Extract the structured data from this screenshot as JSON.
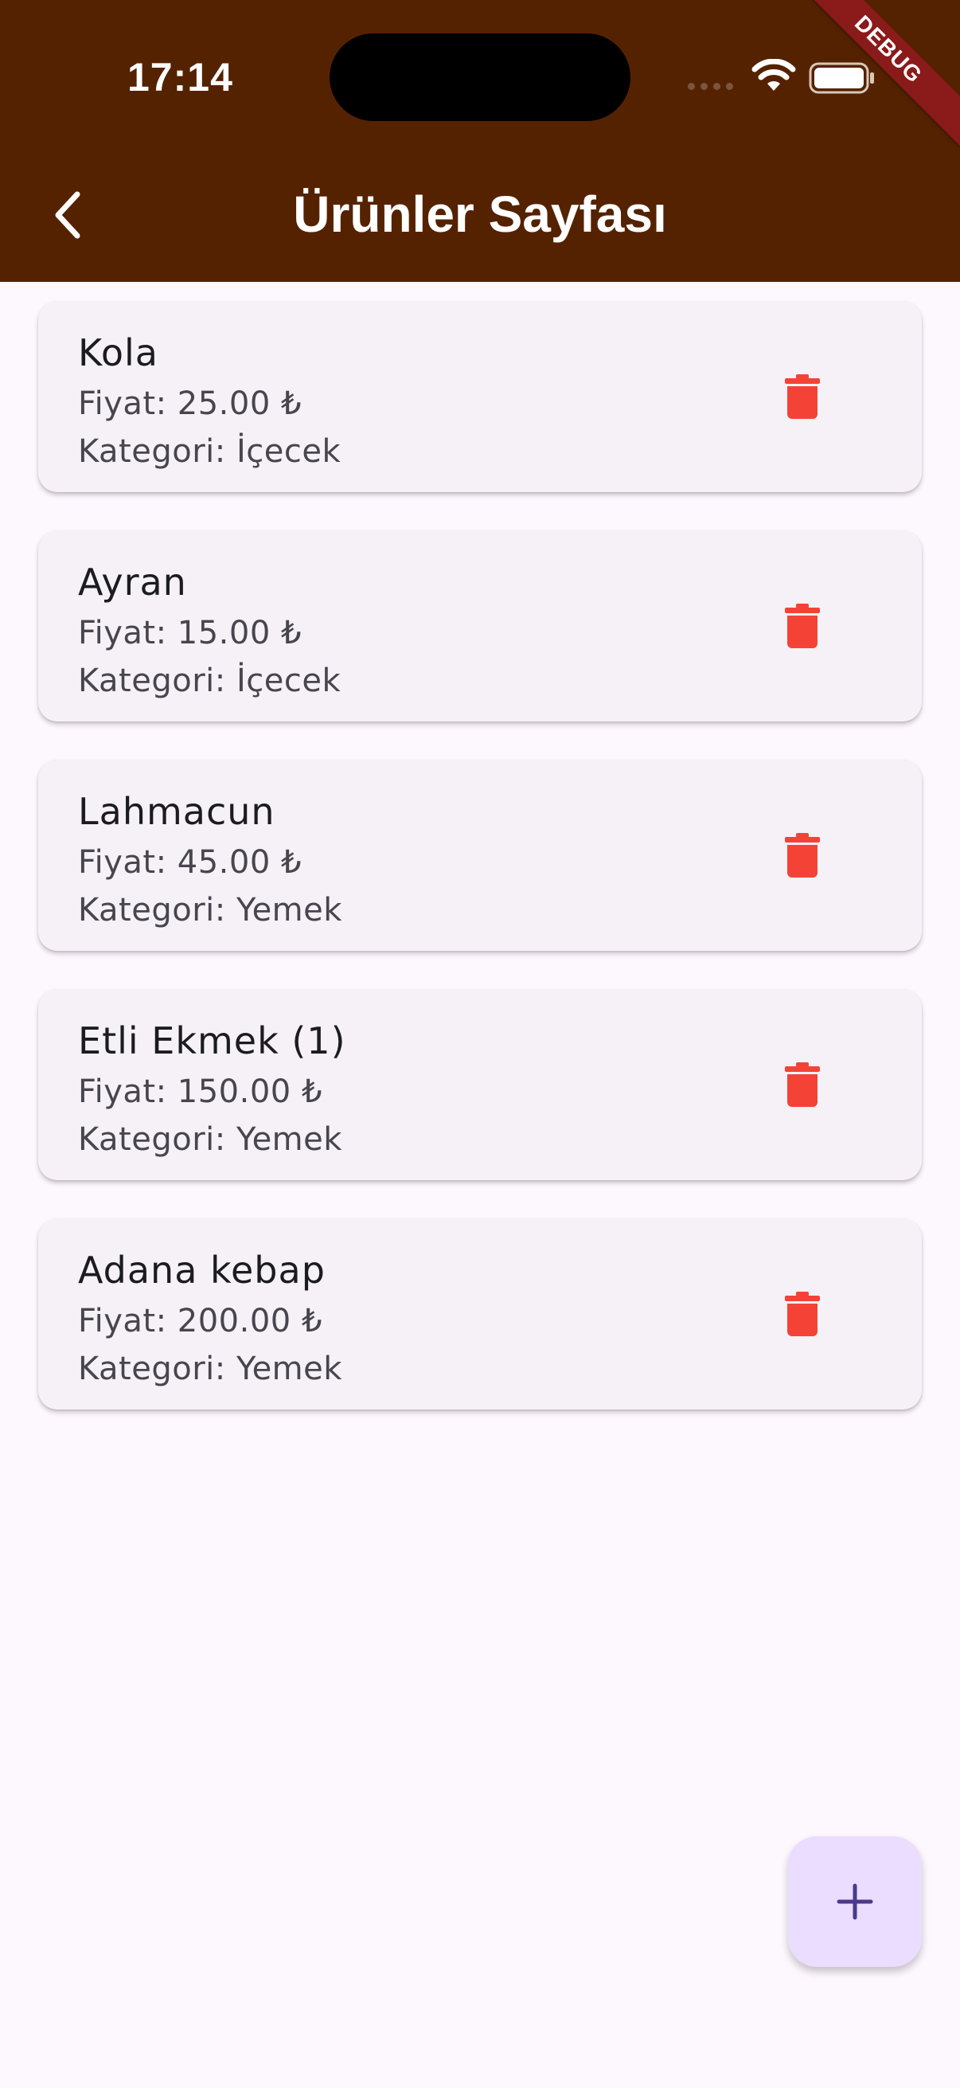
{
  "status_bar": {
    "time": "17:14"
  },
  "debug_banner": "DEBUG",
  "app_bar": {
    "title": "Ürünler Sayfası",
    "back_icon": "chevron-left-icon"
  },
  "products": [
    {
      "name": "Kola",
      "price": "Fiyat: 25.00 ₺",
      "category": "Kategori: İçecek"
    },
    {
      "name": "Ayran",
      "price": "Fiyat: 15.00 ₺",
      "category": "Kategori: İçecek"
    },
    {
      "name": "Lahmacun",
      "price": "Fiyat: 45.00 ₺",
      "category": "Kategori: Yemek"
    },
    {
      "name": "Etli Ekmek (1)",
      "price": "Fiyat: 150.00 ₺",
      "category": "Kategori: Yemek"
    },
    {
      "name": "Adana kebap",
      "price": "Fiyat: 200.00 ₺",
      "category": "Kategori: Yemek"
    }
  ],
  "colors": {
    "app_bar": "#552200",
    "background": "#fdf7fe",
    "card": "#f5f1f7",
    "delete": "#f44336",
    "fab": "#eaddff",
    "fab_icon": "#4a3a8a"
  },
  "fab": {
    "icon": "plus-icon"
  }
}
